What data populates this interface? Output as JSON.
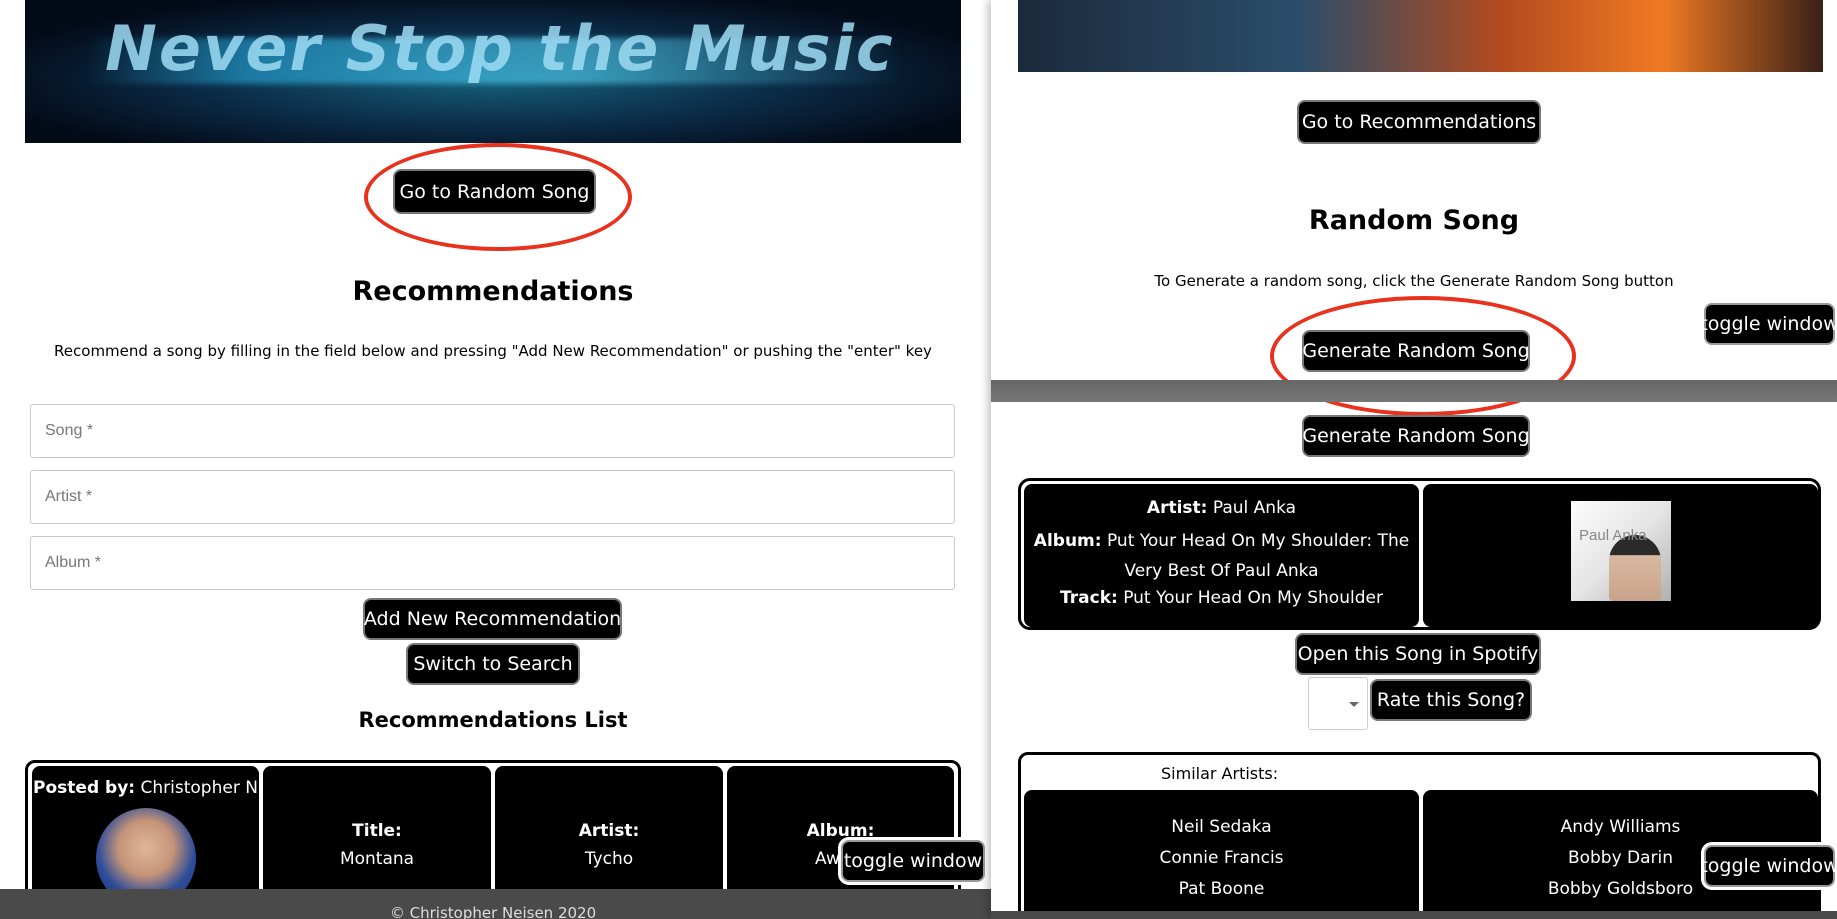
{
  "left": {
    "banner_text": "Never Stop the Music",
    "go_random_label": "Go to Random Song",
    "heading": "Recommendations",
    "instructions": "Recommend a song by filling in the field below and pressing \"Add New Recommendation\" or pushing the \"enter\" key",
    "fields": [
      {
        "placeholder": "Song *"
      },
      {
        "placeholder": "Artist *"
      },
      {
        "placeholder": "Album *"
      }
    ],
    "add_label": "Add New Recommendation",
    "switch_label": "Switch to Search",
    "list_heading": "Recommendations List",
    "rec": {
      "posted_by_label": "Posted by:",
      "posted_by_value": "Christopher N",
      "title_label": "Title:",
      "title_value": "Montana",
      "artist_label": "Artist:",
      "artist_value": "Tycho",
      "album_label": "Album:",
      "album_value": "Awa"
    },
    "toggle_label": "toggle window",
    "footer": "© Christopher Neisen 2020"
  },
  "right": {
    "go_rec_label": "Go to Recommendations",
    "heading": "Random Song",
    "instructions": "To Generate a random song, click the Generate Random Song button",
    "generate_label": "Generate Random Song",
    "toggle_label": "toggle window",
    "song": {
      "artist_label": "Artist:",
      "artist_value": "Paul Anka",
      "album_label": "Album:",
      "album_value": "Put Your Head On My Shoulder: The Very Best Of Paul Anka",
      "track_label": "Track:",
      "track_value": "Put Your Head On My Shoulder",
      "cover_text": "Paul Anka"
    },
    "spotify_label": "Open this Song in Spotify",
    "rate_label": "Rate this Song?",
    "similar_label": "Similar Artists:",
    "similar_left": [
      "Neil Sedaka",
      "Connie Francis",
      "Pat Boone"
    ],
    "similar_right": [
      "Andy Williams",
      "Bobby Darin",
      "Bobby Goldsboro"
    ]
  },
  "colors": {
    "highlight": "#e8321e",
    "button_bg": "#000000"
  }
}
